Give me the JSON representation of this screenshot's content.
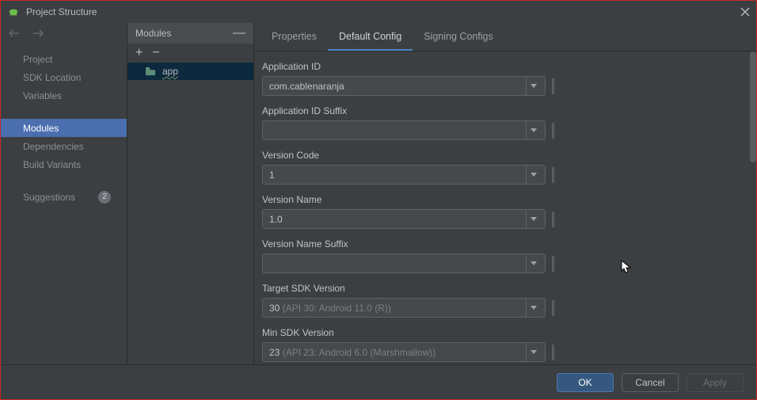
{
  "window": {
    "title": "Project Structure"
  },
  "leftnav": {
    "items": [
      {
        "label": "Project"
      },
      {
        "label": "SDK Location"
      },
      {
        "label": "Variables"
      },
      {
        "label": "Modules",
        "selected": true
      },
      {
        "label": "Dependencies"
      },
      {
        "label": "Build Variants"
      },
      {
        "label": "Suggestions",
        "badge": "2"
      }
    ]
  },
  "modules": {
    "header": "Modules",
    "items": [
      {
        "label": "app"
      }
    ]
  },
  "tabs": [
    {
      "label": "Properties"
    },
    {
      "label": "Default Config",
      "active": true
    },
    {
      "label": "Signing Configs"
    }
  ],
  "form": {
    "application_id": {
      "label": "Application ID",
      "value": "com.cablenaranja"
    },
    "application_id_suffix": {
      "label": "Application ID Suffix",
      "value": ""
    },
    "version_code": {
      "label": "Version Code",
      "value": "1"
    },
    "version_name": {
      "label": "Version Name",
      "value": "1.0"
    },
    "version_name_suffix": {
      "label": "Version Name Suffix",
      "value": ""
    },
    "target_sdk": {
      "label": "Target SDK Version",
      "value": "30",
      "hint": " (API 30: Android 11.0 (R))"
    },
    "min_sdk": {
      "label": "Min SDK Version",
      "value": "23",
      "hint": " (API 23: Android 6.0 (Marshmallow))"
    }
  },
  "buttons": {
    "ok": "OK",
    "cancel": "Cancel",
    "apply": "Apply"
  }
}
